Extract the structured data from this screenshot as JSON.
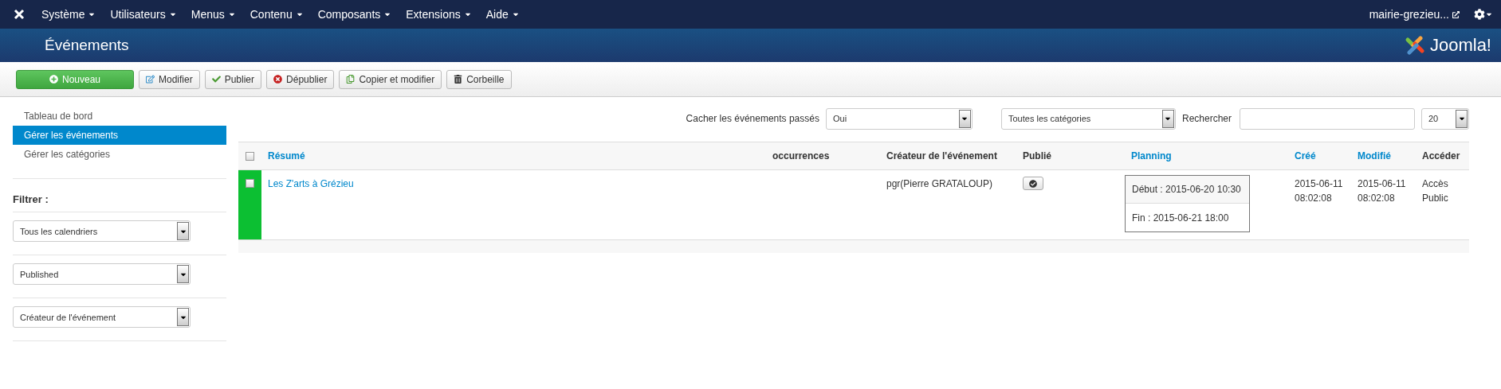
{
  "menu": {
    "items": [
      "Système",
      "Utilisateurs",
      "Menus",
      "Contenu",
      "Composants",
      "Extensions",
      "Aide"
    ],
    "site": "mairie-grezieu..."
  },
  "header": {
    "title": "Événements",
    "brand": "Joomla!"
  },
  "toolbar": [
    {
      "label": "Nouveau",
      "kind": "new"
    },
    {
      "label": "Modifier",
      "kind": "edit"
    },
    {
      "label": "Publier",
      "kind": "publish"
    },
    {
      "label": "Dépublier",
      "kind": "unpublish"
    },
    {
      "label": "Copier et modifier",
      "kind": "copy"
    },
    {
      "label": "Corbeille",
      "kind": "trash"
    }
  ],
  "sidebar": {
    "items": [
      {
        "label": "Tableau de bord",
        "selected": false
      },
      {
        "label": "Gérer les événements",
        "selected": true
      },
      {
        "label": "Gérer les catégories",
        "selected": false
      }
    ],
    "filter_title": "Filtrer :",
    "filters": [
      "Tous les calendriers",
      "Published",
      "Créateur de l'événement"
    ]
  },
  "filter_bar": {
    "hide_past_label": "Cacher les événements passés",
    "hide_past": "Oui",
    "category": "Toutes les catégories",
    "search_label": "Rechercher",
    "limit": "20"
  },
  "table": {
    "select_all_checked": false,
    "columns": [
      {
        "label": "Résumé",
        "link": true
      },
      {
        "label": "occurrences",
        "link": false
      },
      {
        "label": "Créateur de l'événement",
        "link": false
      },
      {
        "label": "Publié",
        "link": false
      },
      {
        "label": "Planning",
        "link": true
      },
      {
        "label": "Créé",
        "link": true
      },
      {
        "label": "Modifié",
        "link": true
      },
      {
        "label": "Accéder",
        "link": false
      }
    ],
    "rows": [
      {
        "checked": false,
        "color": "#0cbf32",
        "summary": "Les Z'arts à Grézieu",
        "creator": "pgr(Pierre GRATALOUP)",
        "published": true,
        "start": "Début : 2015-06-20 10:30",
        "end": "Fin : 2015-06-21 18:00",
        "created": "2015-06-11 08:02:08",
        "modified": "2015-06-11 08:02:08",
        "access": "Accès Public"
      }
    ]
  }
}
